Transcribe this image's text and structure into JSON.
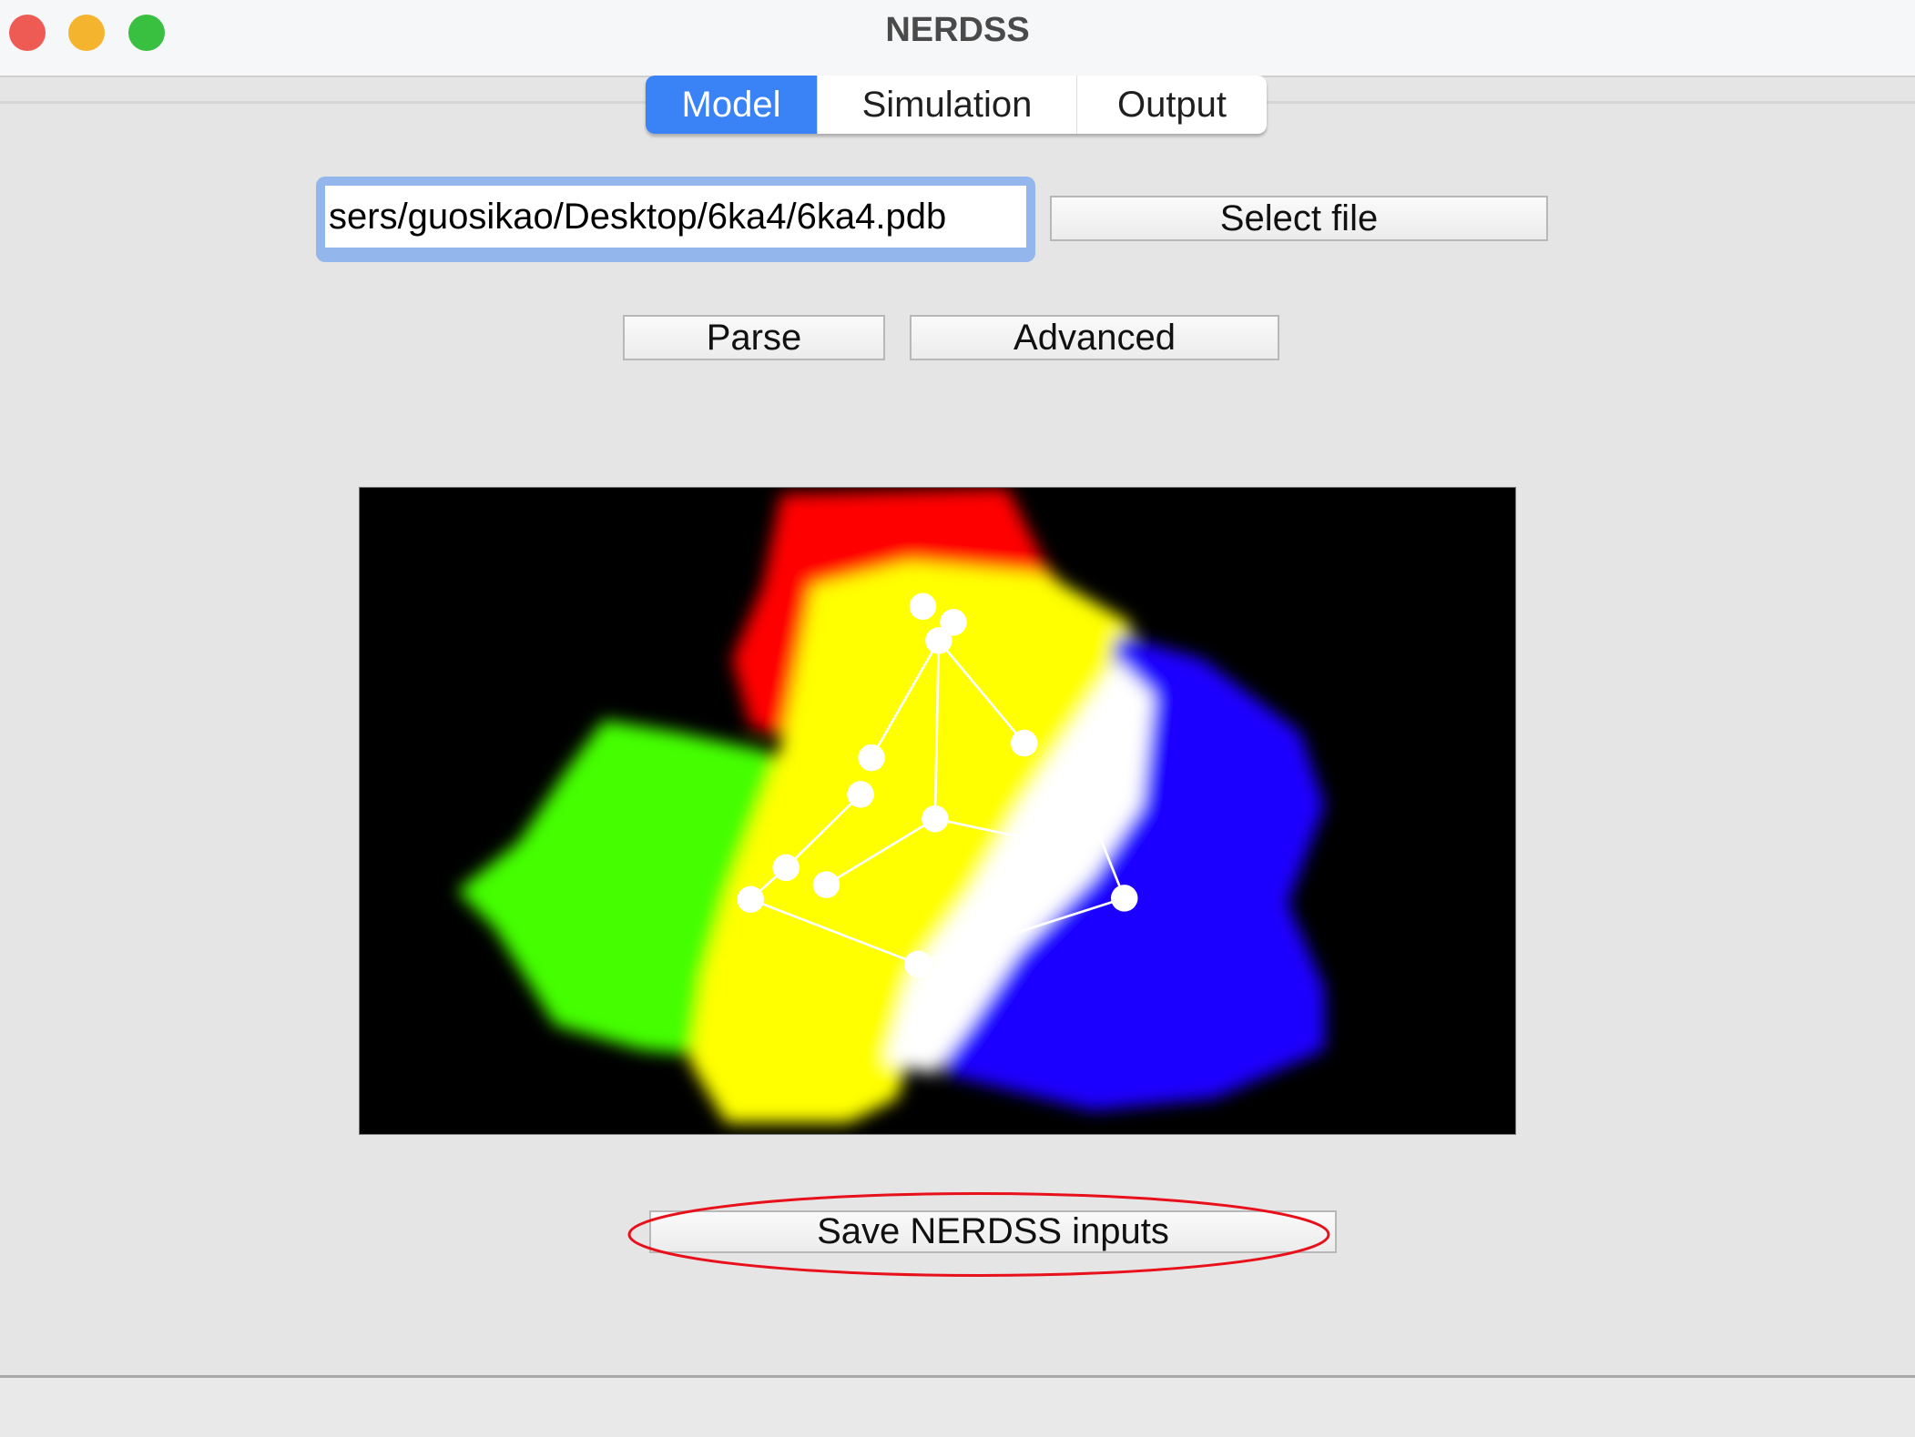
{
  "window": {
    "title": "NERDSS",
    "controls": {
      "close_color": "#ee5b55",
      "minimize_color": "#f5b42d",
      "maximize_color": "#3ac040"
    }
  },
  "tabs": [
    {
      "label": "Model",
      "active": true
    },
    {
      "label": "Simulation",
      "active": false
    },
    {
      "label": "Output",
      "active": false
    }
  ],
  "model": {
    "file_path": "sers/guosikao/Desktop/6ka4/6ka4.pdb",
    "select_file_label": "Select file",
    "parse_label": "Parse",
    "advanced_label": "Advanced",
    "save_label": "Save NERDSS inputs",
    "highlight_color": "#e8101a"
  },
  "colors": {
    "accent": "#3a83f7",
    "chain_colors": [
      "#ff0000",
      "#ffff00",
      "#44ff00",
      "#1a00ff",
      "#ffffff"
    ]
  }
}
